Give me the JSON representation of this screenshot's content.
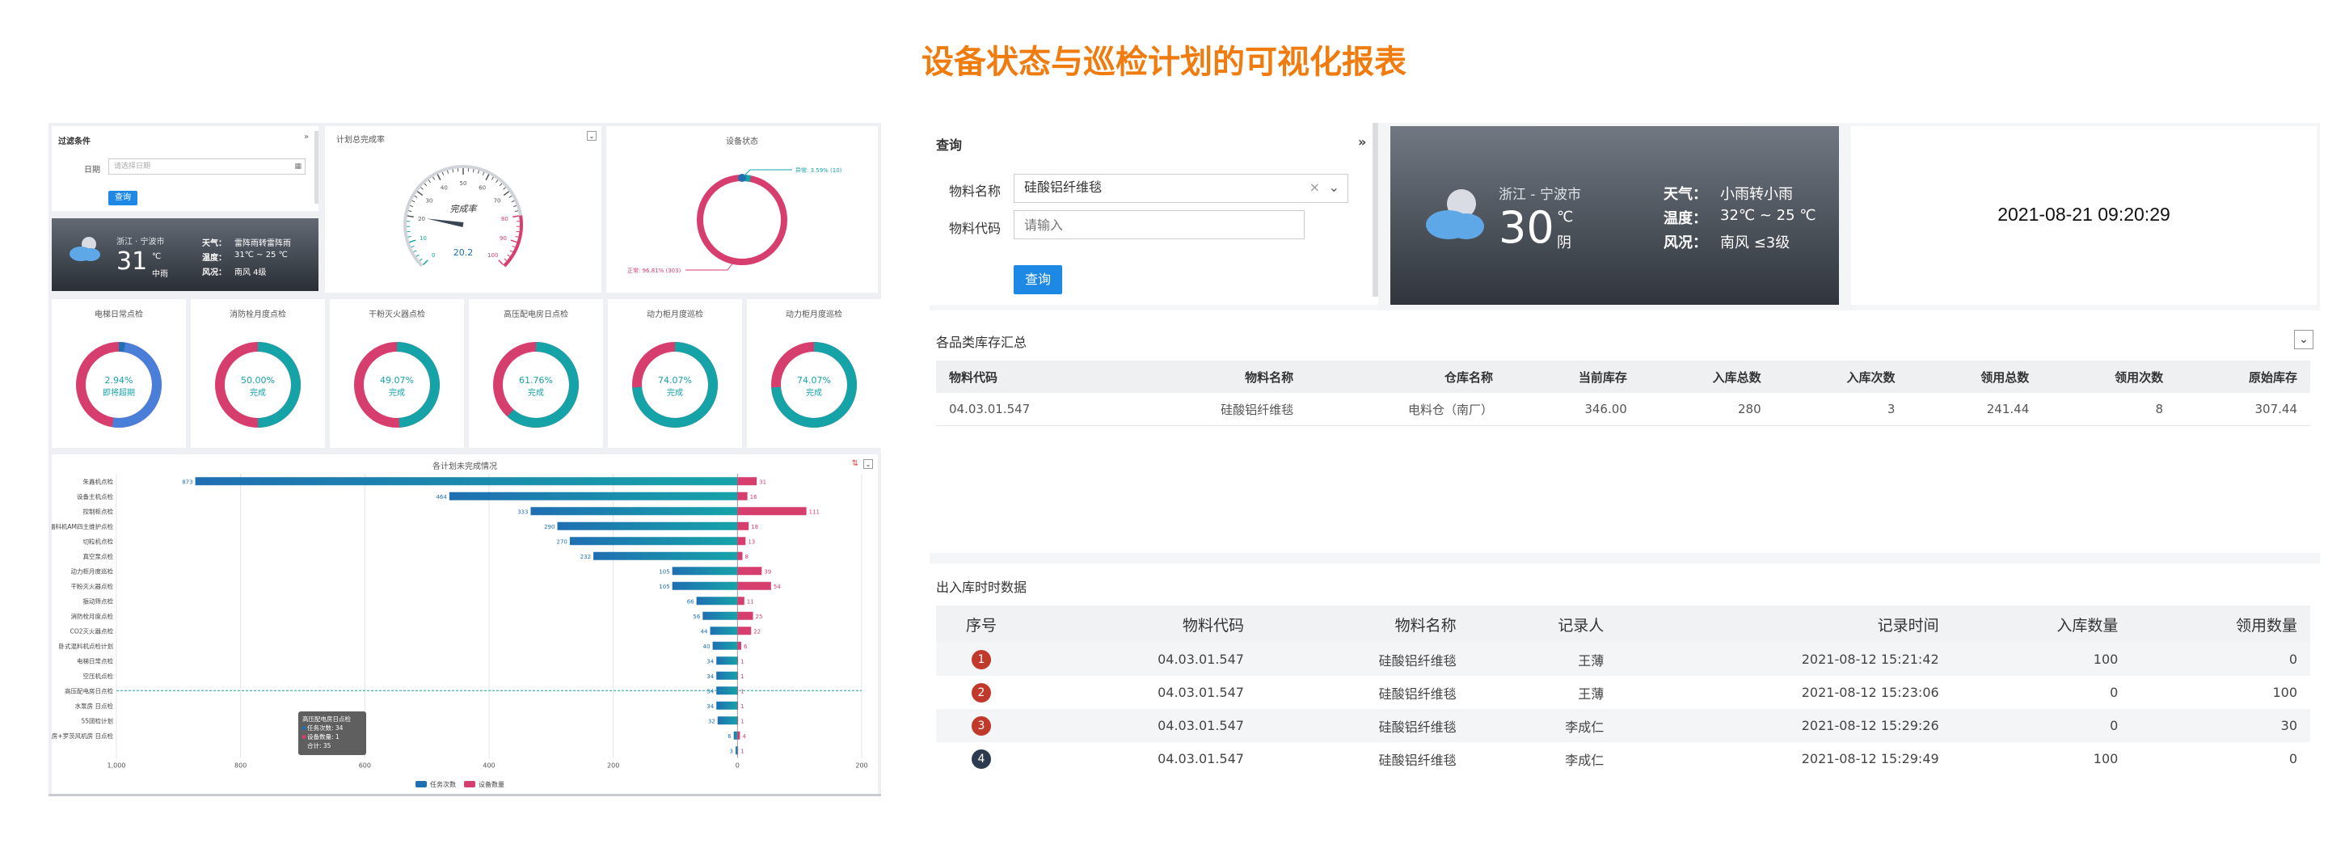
{
  "page_title": "设备状态与巡检计划的可视化报表",
  "left": {
    "filter": {
      "title": "过滤条件",
      "date_label": "日期",
      "date_placeholder": "请选择日期",
      "query_label": "查询"
    },
    "weather": {
      "city": "浙江 · 宁波市",
      "temp": "31",
      "unit": "℃",
      "condition": "中雨",
      "weather_label": "天气：",
      "weather_value": "雷阵雨转雷阵雨",
      "temp_label": "温度：",
      "temp_value": "31℃ ~ 25 ℃",
      "wind_label": "风况：",
      "wind_value": "南风 4级"
    },
    "gauge": {
      "title": "计划总完成率",
      "center_label": "完成率",
      "value_text": "20.2",
      "value": 20.2,
      "ticks": [
        "0",
        "10",
        "20",
        "30",
        "40",
        "50",
        "60",
        "70",
        "80",
        "90",
        "100"
      ]
    },
    "state": {
      "title": "设备状态",
      "abnormal_label": "异常: 3.59% (10)",
      "normal_label": "正常: 96.81% (303)",
      "normal_pct": 96.81
    },
    "rings": [
      {
        "title": "电梯日常点检",
        "pct_text": "2.94%",
        "status": "即将超期",
        "pct": 2.94
      },
      {
        "title": "消防栓月度点检",
        "pct_text": "50.00%",
        "status": "完成",
        "pct": 50.0
      },
      {
        "title": "干粉灭火器点检",
        "pct_text": "49.07%",
        "status": "完成",
        "pct": 49.07
      },
      {
        "title": "高压配电房日点检",
        "pct_text": "61.76%",
        "status": "完成",
        "pct": 61.76
      },
      {
        "title": "动力柜月度巡检",
        "pct_text": "74.07%",
        "status": "完成",
        "pct": 74.07
      },
      {
        "title": "动力柜月度巡检",
        "pct_text": "74.07%",
        "status": "完成",
        "pct": 74.07
      }
    ],
    "colors": {
      "teal": "#16a3a8",
      "blue": "#1f6fb2",
      "pink": "#d63e6e",
      "dark": "#2b303a",
      "accent": "#1e88e5"
    }
  },
  "chart_data": {
    "type": "bar",
    "title": "各计划未完成情况",
    "series": [
      {
        "name": "任务次数",
        "values": [
          873,
          464,
          333,
          290,
          270,
          232,
          105,
          105,
          66,
          56,
          44,
          40,
          34,
          34,
          34,
          34,
          32,
          6,
          3
        ]
      },
      {
        "name": "设备数量",
        "values": [
          31,
          16,
          111,
          18,
          13,
          8,
          39,
          54,
          11,
          25,
          22,
          6,
          1,
          1,
          1,
          1,
          1,
          4,
          1
        ]
      }
    ],
    "categories": [
      "朱鑫机点检",
      "设备主机点检",
      "控制柜点检",
      "福科机AM四主维护点检",
      "切粒机点检",
      "真空泵点检",
      "动力柜月度巡检",
      "干粉灭火器点检",
      "振动筛点检",
      "消防栓月度点检",
      "CO2灭火器点检",
      "卧式混料机点检计划",
      "电梯日常点检",
      "空压机点检",
      "高压配电房日点检",
      "水泵房 日点检",
      "55团检计划",
      "水泵房+罗茨风机房 日点检",
      ""
    ],
    "x_ticks": [
      "1,000",
      "800",
      "600",
      "400",
      "200",
      "0",
      "200"
    ],
    "xlim": [
      -1000,
      200
    ],
    "legend": [
      "任务次数",
      "设备数量"
    ],
    "tooltip": {
      "title": "高压配电房日点检",
      "line1": "任务次数: 34",
      "line2": "设备数量: 1",
      "line3": "合计: 35"
    }
  },
  "right": {
    "query": {
      "title": "查询",
      "material_name_label": "物料名称",
      "material_name_value": "硅酸铝纤维毯",
      "material_code_label": "物料代码",
      "material_code_placeholder": "请输入",
      "button": "查询"
    },
    "weather": {
      "city": "浙江 - 宁波市",
      "temp": "30",
      "unit": "℃",
      "condition": "阴",
      "weather_label": "天气：",
      "weather_value": "小雨转小雨",
      "temp_label": "温度：",
      "temp_value": "32℃ ~ 25 ℃",
      "wind_label": "风况：",
      "wind_value": "南风 ≤3级"
    },
    "datetime": "2021-08-21 09:20:29",
    "inventory": {
      "title": "各品类库存汇总",
      "columns": [
        "物料代码",
        "物料名称",
        "仓库名称",
        "当前库存",
        "入库总数",
        "入库次数",
        "领用总数",
        "领用次数",
        "原始库存"
      ],
      "rows": [
        [
          "04.03.01.547",
          "硅酸铝纤维毯",
          "电料仓（南厂）",
          "346.00",
          "280",
          "3",
          "241.44",
          "8",
          "307.44"
        ]
      ]
    },
    "realtime": {
      "title": "出入库时时数据",
      "columns": [
        "序号",
        "物料代码",
        "物料名称",
        "记录人",
        "记录时间",
        "入库数量",
        "领用数量"
      ],
      "rows": [
        [
          "1",
          "04.03.01.547",
          "硅酸铝纤维毯",
          "王薄",
          "2021-08-12 15:21:42",
          "100",
          "0"
        ],
        [
          "2",
          "04.03.01.547",
          "硅酸铝纤维毯",
          "王薄",
          "2021-08-12 15:23:06",
          "0",
          "100"
        ],
        [
          "3",
          "04.03.01.547",
          "硅酸铝纤维毯",
          "李成仁",
          "2021-08-12 15:29:26",
          "0",
          "30"
        ],
        [
          "4",
          "04.03.01.547",
          "硅酸铝纤维毯",
          "李成仁",
          "2021-08-12 15:29:49",
          "100",
          "0"
        ]
      ]
    }
  }
}
